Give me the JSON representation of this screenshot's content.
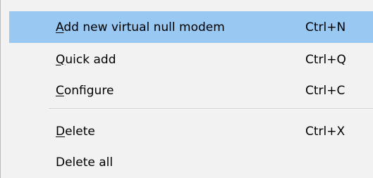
{
  "menu": {
    "items": [
      {
        "mnemonic": "A",
        "rest": "dd new virtual null modem",
        "shortcut": "Ctrl+N"
      },
      {
        "mnemonic": "Q",
        "rest": "uick add",
        "shortcut": "Ctrl+Q"
      },
      {
        "mnemonic": "C",
        "rest": "onfigure",
        "shortcut": "Ctrl+C"
      },
      {
        "mnemonic": "D",
        "rest": "elete",
        "shortcut": "Ctrl+X"
      },
      {
        "mnemonic": "",
        "rest": "Delete all",
        "shortcut": ""
      }
    ]
  },
  "colors": {
    "highlight": "#99c8f2",
    "menu_background": "#f2f2f2",
    "separator": "#d2d2d2"
  }
}
